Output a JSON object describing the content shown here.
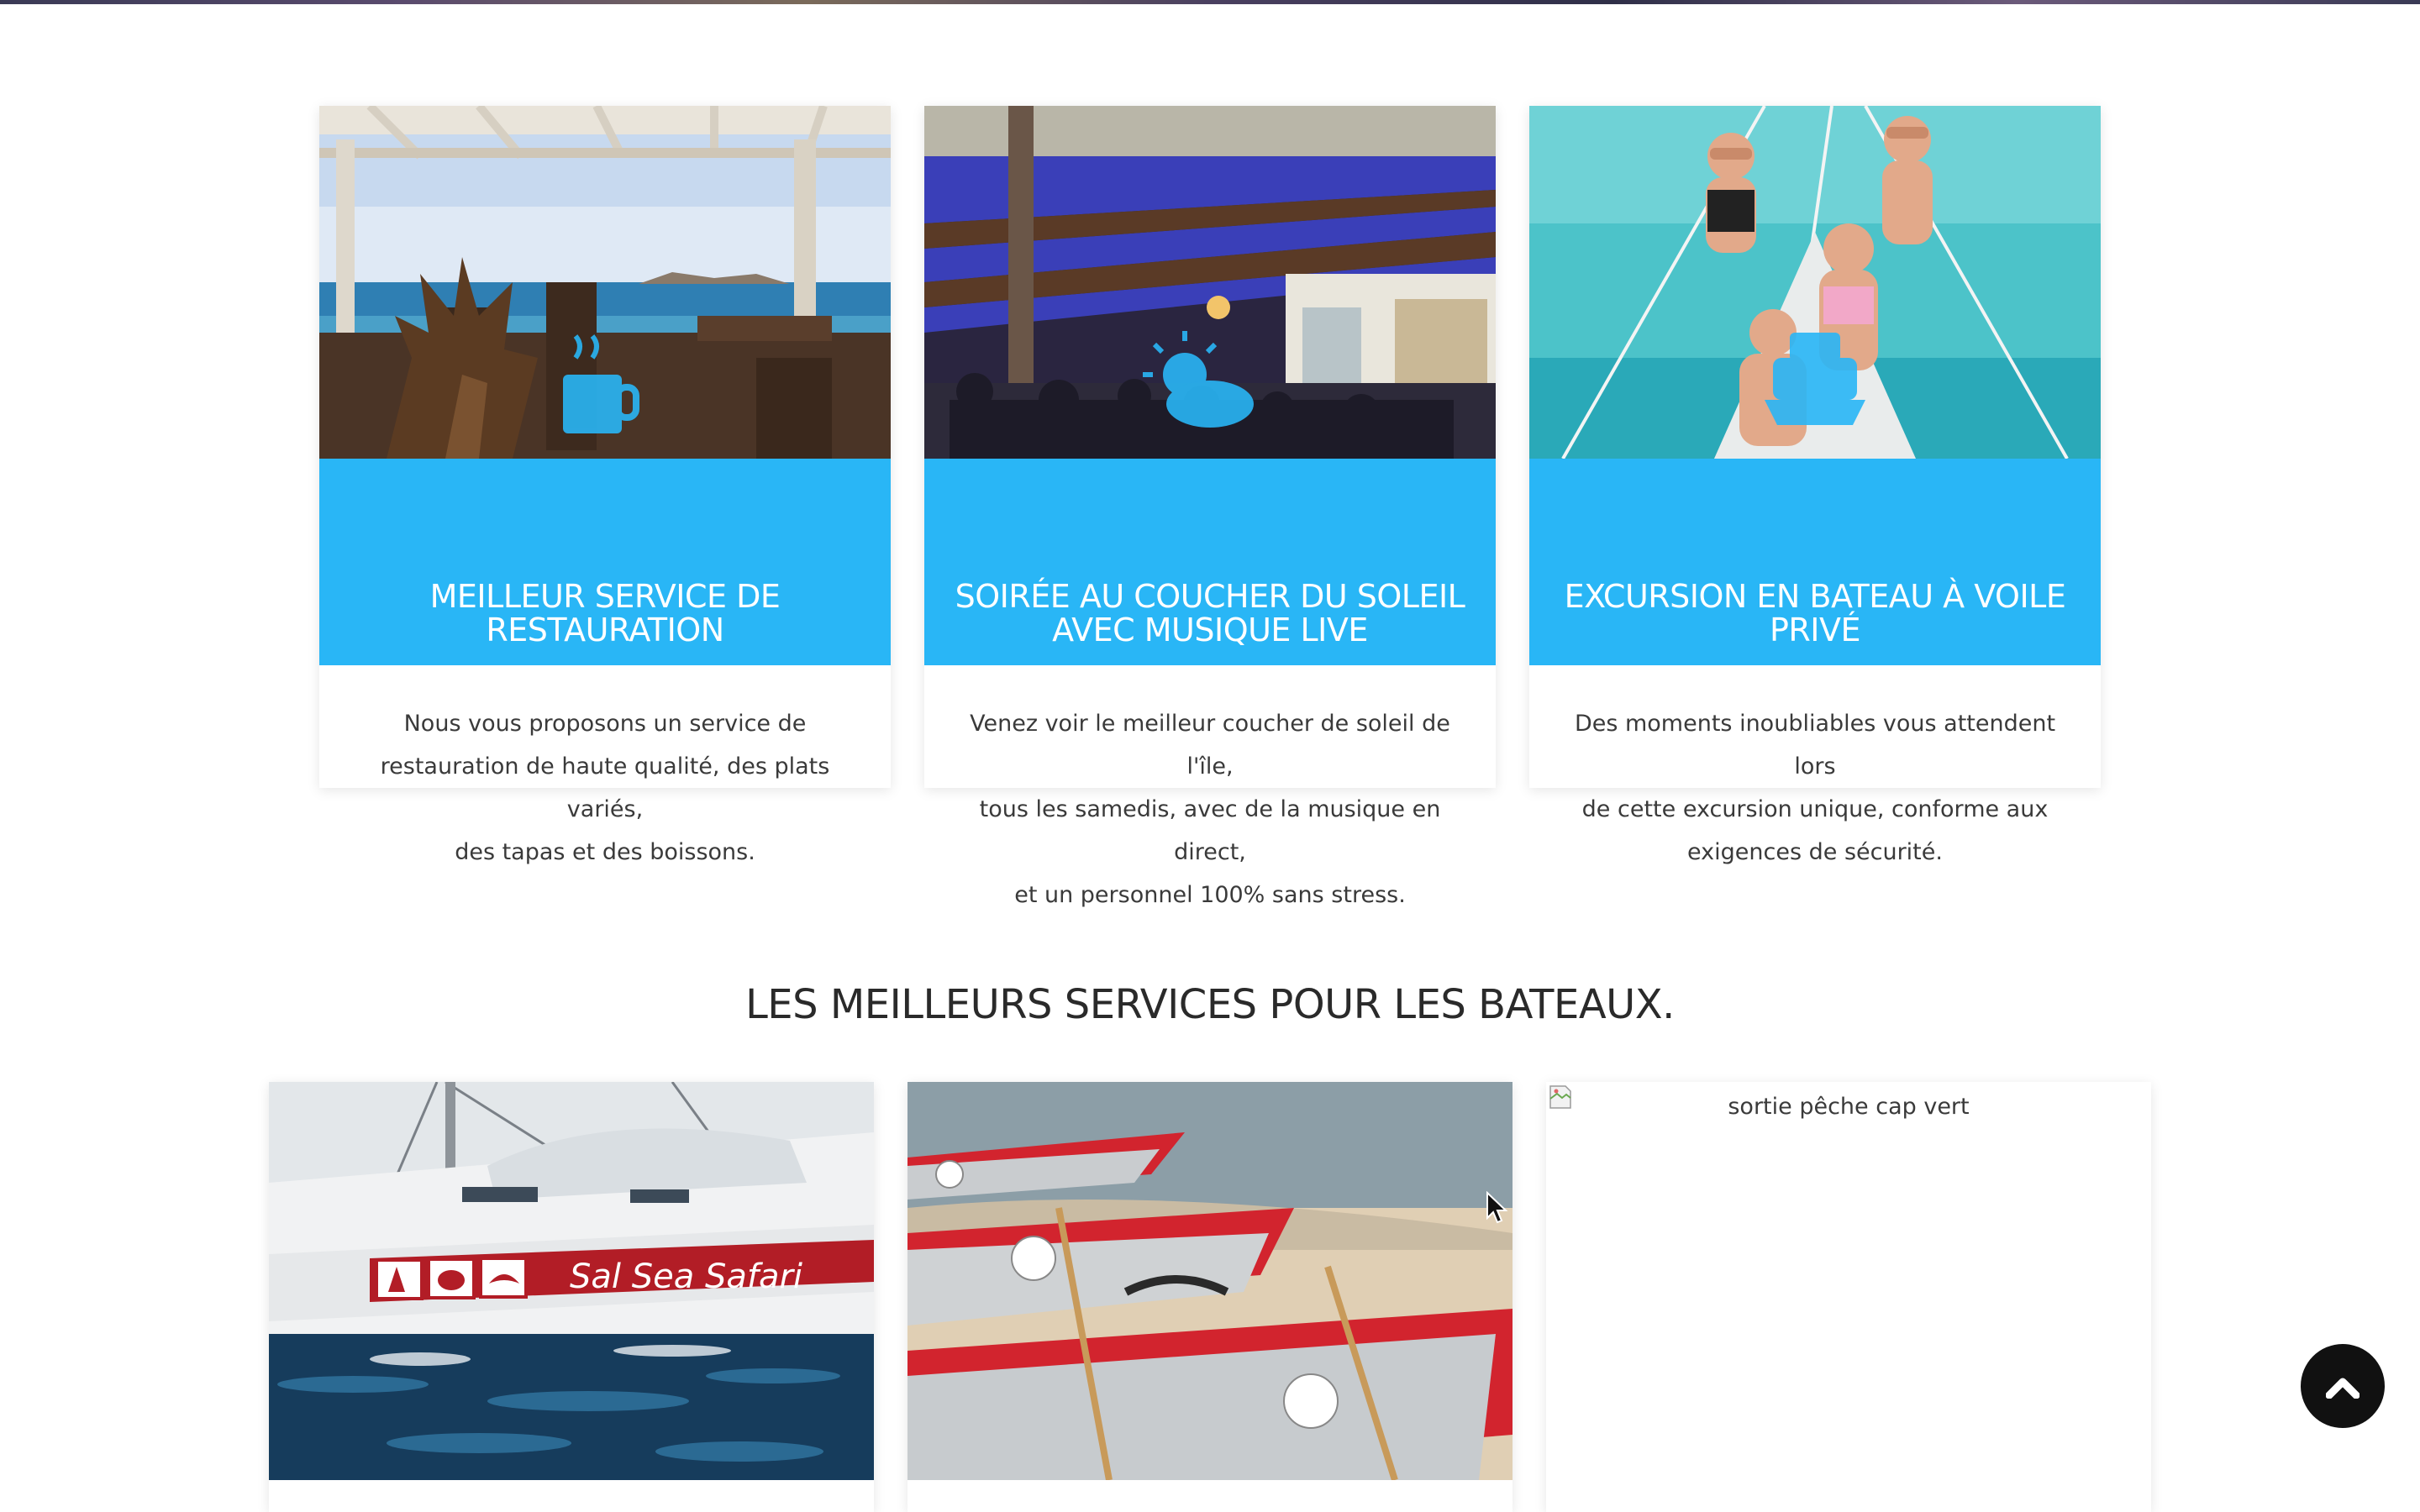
{
  "services": [
    {
      "title_lines": [
        "MEILLEUR SERVICE DE",
        "RESTAURATION"
      ],
      "text_lines": [
        "Nous vous proposons un service de",
        "restauration de haute qualité, des plats variés,",
        "des tapas et des boissons."
      ],
      "icon": "coffee-cup-icon"
    },
    {
      "title_lines": [
        "SOIRÉE AU COUCHER DU SOLEIL",
        "AVEC MUSIQUE LIVE"
      ],
      "text_lines": [
        "Venez voir le meilleur coucher de soleil de l'île,",
        "tous les samedis, avec de la musique en direct,",
        "et un personnel 100% sans stress."
      ],
      "icon": "sun-cloud-icon"
    },
    {
      "title_lines": [
        "EXCURSION EN BATEAU À VOILE",
        "PRIVÉ"
      ],
      "text_lines": [
        "Des moments inoubliables vous attendent lors",
        "de cette excursion unique, conforme aux",
        "exigences de sécurité."
      ],
      "icon": "ship-icon"
    }
  ],
  "boats_section": {
    "title": "LES MEILLEURS SERVICES POUR LES BATEAUX.",
    "hull_text": "Sal Sea Safari",
    "broken_image_alt": "sortie pêche cap vert"
  },
  "colors": {
    "accent": "#29b6f6",
    "scroll_button": "#111111"
  },
  "scroll_top_icon": "chevron-up-icon"
}
